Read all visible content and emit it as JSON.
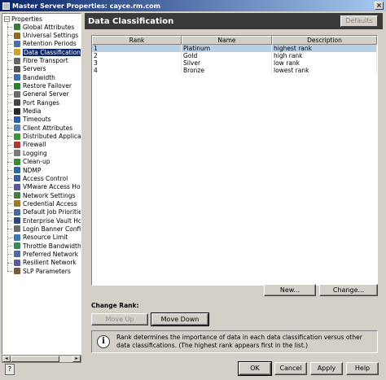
{
  "window": {
    "title": "Master Server Properties: cayce.rm.com",
    "close_label": "×"
  },
  "tree": {
    "root_label": "Properties",
    "root_expander": "−",
    "items": [
      {
        "label": "Global Attributes",
        "icon": "globe-icon",
        "color": "#3c7a3c"
      },
      {
        "label": "Universal Settings",
        "icon": "settings-icon",
        "color": "#8a6b2a"
      },
      {
        "label": "Retention Periods",
        "icon": "calendar-icon",
        "color": "#4a6fa5"
      },
      {
        "label": "Data Classification",
        "icon": "classification-icon",
        "color": "#c9a227",
        "selected": true
      },
      {
        "label": "Fibre Transport",
        "icon": "fibre-icon",
        "color": "#666666"
      },
      {
        "label": "Servers",
        "icon": "servers-icon",
        "color": "#555555"
      },
      {
        "label": "Bandwidth",
        "icon": "bandwidth-icon",
        "color": "#3a6ea5"
      },
      {
        "label": "Restore Failover",
        "icon": "restore-icon",
        "color": "#2f7d32"
      },
      {
        "label": "General Server",
        "icon": "server-icon",
        "color": "#6a6a6a"
      },
      {
        "label": "Port Ranges",
        "icon": "port-icon",
        "color": "#444444"
      },
      {
        "label": "Media",
        "icon": "media-icon",
        "color": "#2a2a2a"
      },
      {
        "label": "Timeouts",
        "icon": "clock-icon",
        "color": "#2a5db0"
      },
      {
        "label": "Client Attributes",
        "icon": "client-icon",
        "color": "#5a7fb0"
      },
      {
        "label": "Distributed Applicatio",
        "icon": "distributed-icon",
        "color": "#3f8f3f"
      },
      {
        "label": "Firewall",
        "icon": "firewall-icon",
        "color": "#b03a2e"
      },
      {
        "label": "Logging",
        "icon": "logging-icon",
        "color": "#7a7a7a"
      },
      {
        "label": "Clean-up",
        "icon": "cleanup-icon",
        "color": "#3a8a3a"
      },
      {
        "label": "NDMP",
        "icon": "ndmp-icon",
        "color": "#2a6aa0"
      },
      {
        "label": "Access Control",
        "icon": "access-icon",
        "color": "#3a5fa0"
      },
      {
        "label": "VMware Access Hosts",
        "icon": "vmware-icon",
        "color": "#5a5a9a"
      },
      {
        "label": "Network Settings",
        "icon": "network-icon",
        "color": "#4a7a4a"
      },
      {
        "label": "Credential Access",
        "icon": "credential-icon",
        "color": "#9a7a2a"
      },
      {
        "label": "Default Job Priorities",
        "icon": "priority-icon",
        "color": "#4a6a9a"
      },
      {
        "label": "Enterprise Vault Hosts",
        "icon": "vault-icon",
        "color": "#2a4a7a"
      },
      {
        "label": "Login Banner Configu",
        "icon": "banner-icon",
        "color": "#6a6a6a"
      },
      {
        "label": "Resource Limit",
        "icon": "resource-icon",
        "color": "#3a7ab0"
      },
      {
        "label": "Throttle Bandwidth",
        "icon": "throttle-icon",
        "color": "#3a8a5a"
      },
      {
        "label": "Preferred Network",
        "icon": "preferred-network-icon",
        "color": "#4a6aa0"
      },
      {
        "label": "Resilient Network",
        "icon": "resilient-network-icon",
        "color": "#5a5aa0"
      },
      {
        "label": "SLP Parameters",
        "icon": "slp-icon",
        "color": "#7a5a3a"
      }
    ]
  },
  "panel": {
    "title": "Data Classification",
    "defaults_label": "Defaults",
    "table": {
      "columns": [
        "Rank",
        "Name",
        "Description"
      ],
      "rows": [
        {
          "rank": "1",
          "name": "Platinum",
          "description": "highest rank",
          "selected": true
        },
        {
          "rank": "2",
          "name": "Gold",
          "description": "high rank"
        },
        {
          "rank": "3",
          "name": "Silver",
          "description": "low rank"
        },
        {
          "rank": "4",
          "name": "Bronze",
          "description": "lowest rank"
        }
      ]
    },
    "new_label": "New...",
    "change_label": "Change...",
    "change_rank_label": "Change Rank:",
    "move_up_label": "Move Up",
    "move_down_label": "Move Down",
    "info_icon": "i",
    "info_text": "Rank determines the importance of data in each data classification versus other data classifications. (The highest rank appears first in the list.)"
  },
  "footer": {
    "help_icon": "?",
    "ok_label": "OK",
    "cancel_label": "Cancel",
    "apply_label": "Apply",
    "help_label": "Help"
  }
}
